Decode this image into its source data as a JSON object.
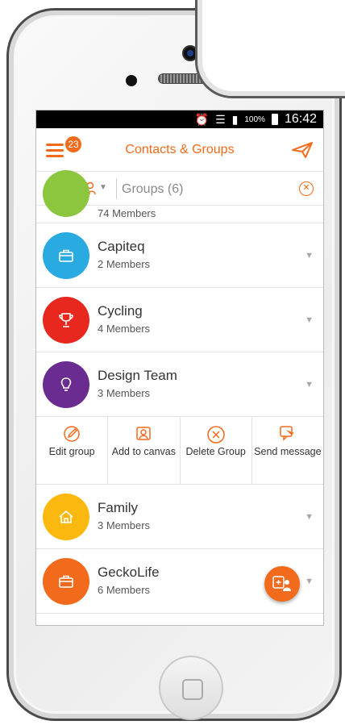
{
  "status_bar": {
    "battery_pct": "100%",
    "time": "16:42",
    "icons": [
      "alarm-icon",
      "wifi-icon",
      "signal-icon",
      "battery-icon"
    ]
  },
  "app_bar": {
    "menu_badge": "23",
    "title": "Contacts & Groups",
    "send_icon": "send-icon"
  },
  "search_bar": {
    "filter_text": "Groups (6)",
    "icons": [
      "phone-contacts-icon",
      "group-filter-icon",
      "clear-icon"
    ]
  },
  "groups": [
    {
      "name": "",
      "members": "74 Members",
      "color": "#8cc63f",
      "icon": "group-icon"
    },
    {
      "name": "Capiteq",
      "members": "2 Members",
      "color": "#29abe2",
      "icon": "briefcase-icon"
    },
    {
      "name": "Cycling",
      "members": "4 Members",
      "color": "#e8281e",
      "icon": "trophy-icon"
    },
    {
      "name": "Design Team",
      "members": "3 Members",
      "color": "#6b2c91",
      "icon": "lightbulb-icon"
    },
    {
      "name": "Family",
      "members": "3 Members",
      "color": "#fbb80f",
      "icon": "home-icon"
    },
    {
      "name": "GeckoLife",
      "members": "6 Members",
      "color": "#f26a1b",
      "icon": "briefcase-icon"
    }
  ],
  "group_actions": [
    {
      "label": "Edit group",
      "icon": "edit-icon"
    },
    {
      "label": "Add to canvas",
      "icon": "add-to-canvas-icon"
    },
    {
      "label": "Delete Group",
      "icon": "delete-icon"
    },
    {
      "label": "Send message",
      "icon": "send-message-icon"
    }
  ],
  "colors": {
    "accent": "#f26a1b"
  }
}
